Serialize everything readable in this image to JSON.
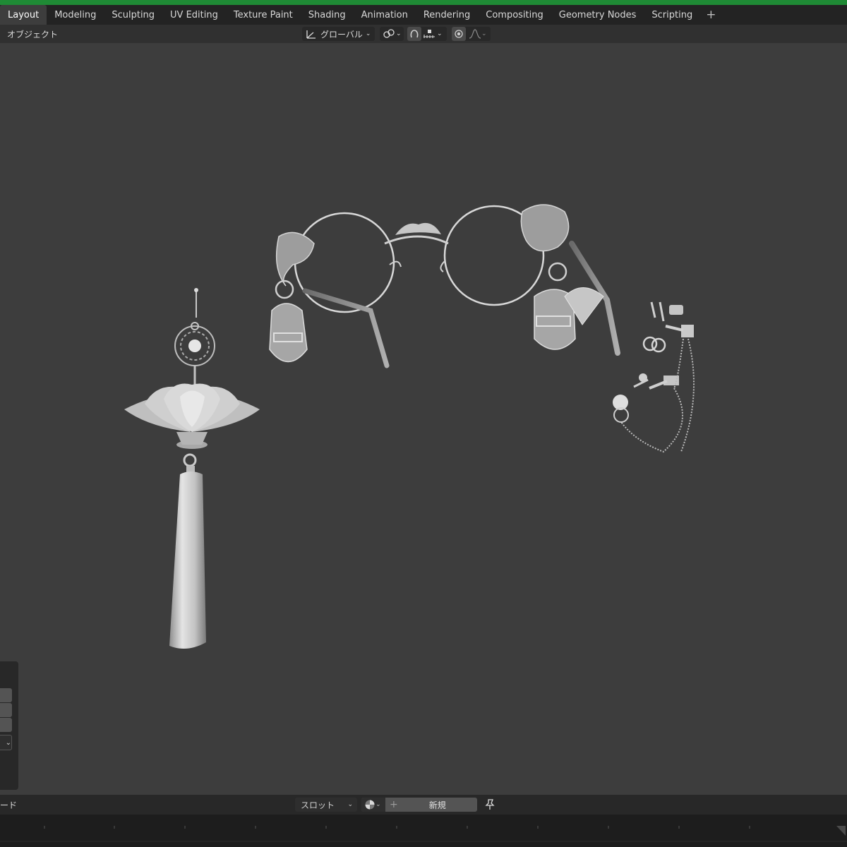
{
  "tabs": [
    "Layout",
    "Modeling",
    "Sculpting",
    "UV Editing",
    "Texture Paint",
    "Shading",
    "Animation",
    "Rendering",
    "Compositing",
    "Geometry Nodes",
    "Scripting"
  ],
  "header": {
    "mode": "オブジェクト",
    "orientation": "グローバル"
  },
  "bottom": {
    "left_label": "ード",
    "slot": "スロット",
    "new_button": "新規"
  },
  "colors": {
    "top_strip": "#1f8a35",
    "tabbar_bg": "#232323",
    "viewport_bg": "#3d3d3d",
    "header_bg": "#303030",
    "model": "#c9c9c9"
  }
}
